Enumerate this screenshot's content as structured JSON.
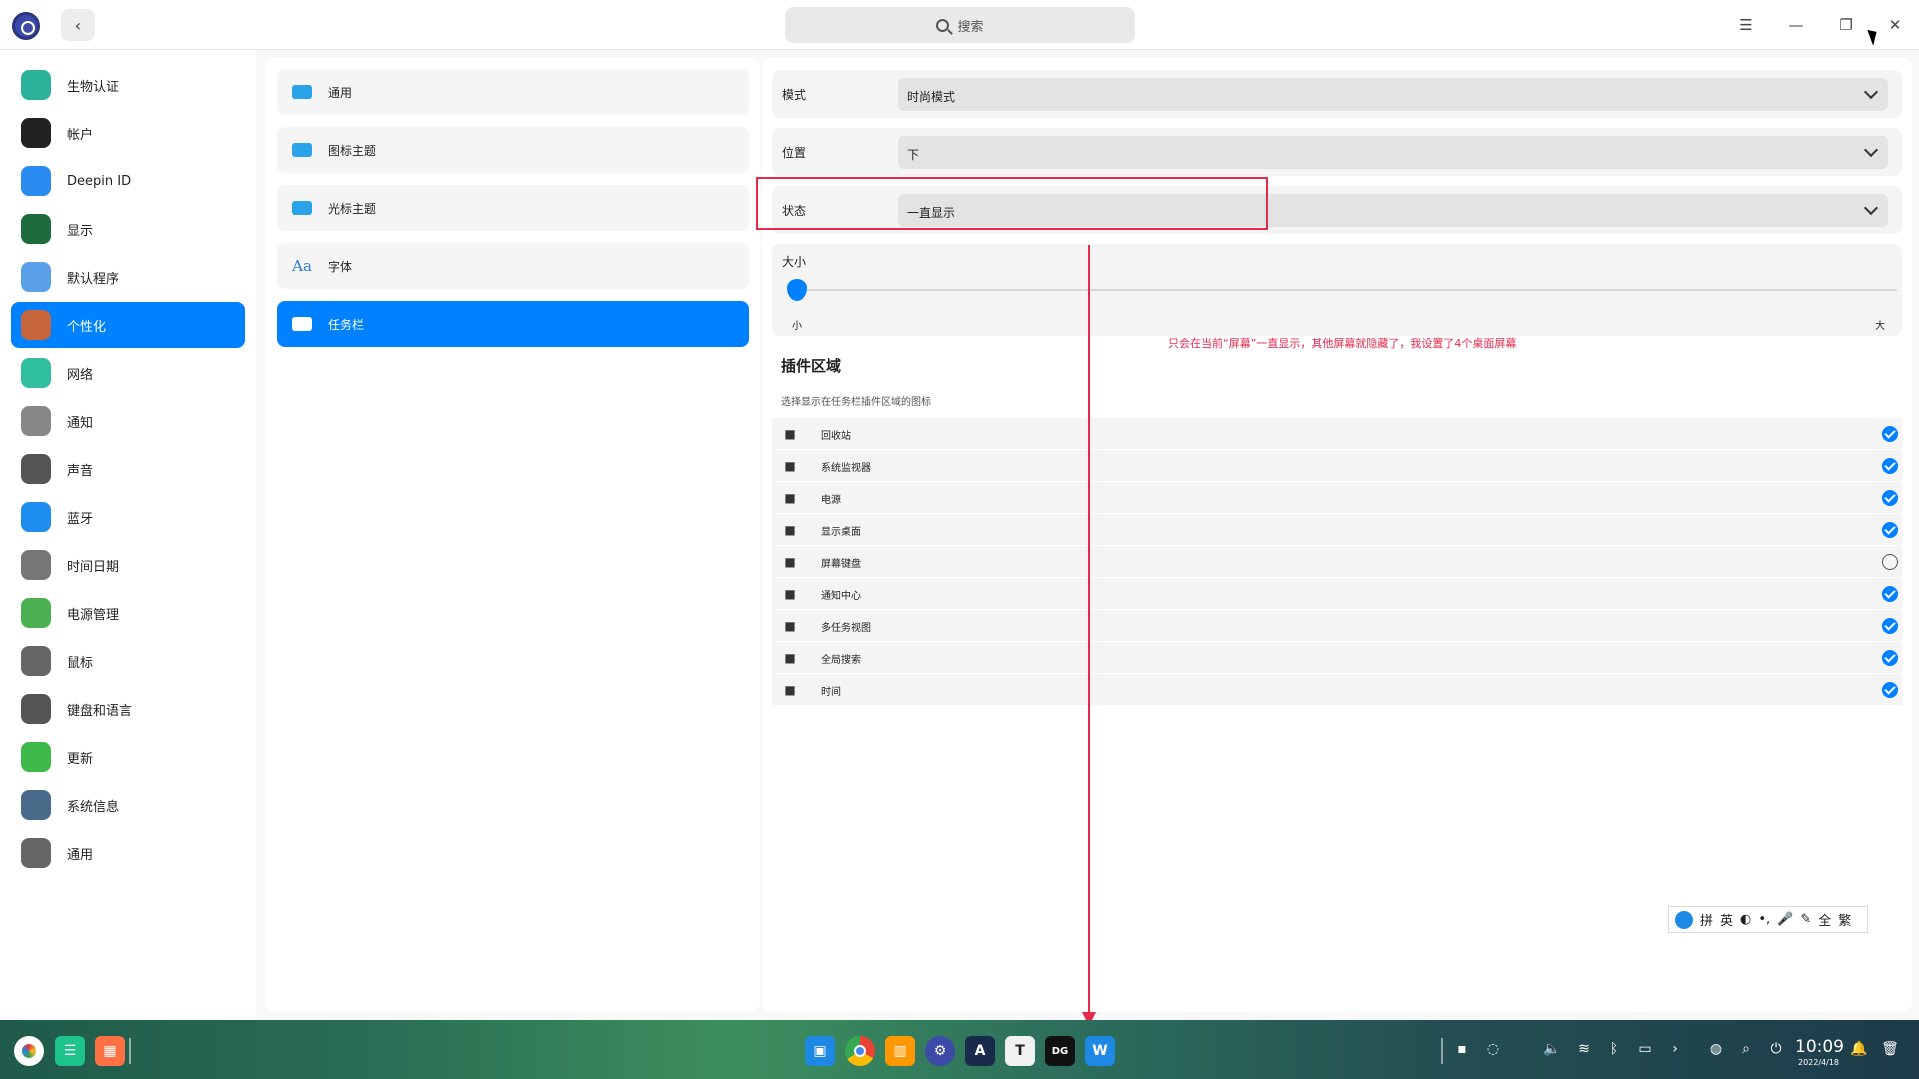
{
  "titlebar": {
    "search_label": "搜索"
  },
  "sidebar": {
    "items": [
      {
        "label": "生物认证",
        "icon": "fingerprint-icon",
        "color": "#2ab39a",
        "active": false
      },
      {
        "label": "帐户",
        "icon": "account-icon",
        "color": "#222222",
        "active": false
      },
      {
        "label": "Deepin ID",
        "icon": "cloud-icon",
        "color": "#2a8cf0",
        "active": false
      },
      {
        "label": "显示",
        "icon": "display-icon",
        "color": "#1e6b3c",
        "active": false
      },
      {
        "label": "默认程序",
        "icon": "default-apps-icon",
        "color": "#5aa0e8",
        "active": false
      },
      {
        "label": "个性化",
        "icon": "personalization-icon",
        "color": "#c7663a",
        "active": true
      },
      {
        "label": "网络",
        "icon": "network-icon",
        "color": "#2fbf9f",
        "active": false
      },
      {
        "label": "通知",
        "icon": "bell-icon",
        "color": "#888888",
        "active": false
      },
      {
        "label": "声音",
        "icon": "speaker-icon",
        "color": "#555555",
        "active": false
      },
      {
        "label": "蓝牙",
        "icon": "bluetooth-icon",
        "color": "#1e8df0",
        "active": false
      },
      {
        "label": "时间日期",
        "icon": "clock-icon",
        "color": "#777777",
        "active": false
      },
      {
        "label": "电源管理",
        "icon": "battery-icon",
        "color": "#4caf50",
        "active": false
      },
      {
        "label": "鼠标",
        "icon": "mouse-icon",
        "color": "#666666",
        "active": false
      },
      {
        "label": "键盘和语言",
        "icon": "keyboard-icon",
        "color": "#555555",
        "active": false
      },
      {
        "label": "更新",
        "icon": "update-icon",
        "color": "#3db84a",
        "active": false
      },
      {
        "label": "系统信息",
        "icon": "system-info-icon",
        "color": "#4a6a8a",
        "active": false
      },
      {
        "label": "通用",
        "icon": "general-icon",
        "color": "#666666",
        "active": false
      }
    ]
  },
  "midpanel": {
    "items": [
      {
        "label": "通用",
        "icon": "window-icon",
        "active": false
      },
      {
        "label": "图标主题",
        "icon": "icon-theme-icon",
        "active": false
      },
      {
        "label": "光标主题",
        "icon": "cursor-theme-icon",
        "active": false
      },
      {
        "label": "字体",
        "icon": "font-icon",
        "glyph": "Aa",
        "active": false
      },
      {
        "label": "任务栏",
        "icon": "taskbar-icon",
        "active": true
      }
    ]
  },
  "settings": {
    "mode": {
      "label": "模式",
      "value": "时尚模式"
    },
    "position": {
      "label": "位置",
      "value": "下"
    },
    "status": {
      "label": "状态",
      "value": "一直显示"
    },
    "size": {
      "label": "大小",
      "min_label": "小",
      "max_label": "大",
      "level": 0
    }
  },
  "plugins": {
    "title": "插件区域",
    "subtitle": "选择显示在任务栏插件区域的图标",
    "items": [
      {
        "label": "回收站",
        "icon": "trash-icon",
        "checked": true
      },
      {
        "label": "系统监视器",
        "icon": "system-monitor-icon",
        "checked": true
      },
      {
        "label": "电源",
        "icon": "power-icon",
        "checked": true
      },
      {
        "label": "显示桌面",
        "icon": "show-desktop-icon",
        "checked": true
      },
      {
        "label": "屏幕键盘",
        "icon": "onscreen-keyboard-icon",
        "checked": false
      },
      {
        "label": "通知中心",
        "icon": "notification-center-icon",
        "checked": true
      },
      {
        "label": "多任务视图",
        "icon": "multitask-view-icon",
        "checked": true
      },
      {
        "label": "全局搜索",
        "icon": "global-search-icon",
        "checked": true
      },
      {
        "label": "时间",
        "icon": "time-icon",
        "checked": true
      }
    ]
  },
  "annotation": {
    "text": "只会在当前“屏幕”一直显示，其他屏幕就隐藏了，我设置了4个桌面屏幕",
    "color": "#e8294c"
  },
  "ime": {
    "items": [
      "拼",
      "英",
      "◐",
      "•,",
      "🎤",
      "✎",
      "全",
      "繁"
    ]
  },
  "taskbar": {
    "clock_time": "10:09",
    "clock_date": "2022/4/18"
  },
  "accent_color": "#0081ff"
}
